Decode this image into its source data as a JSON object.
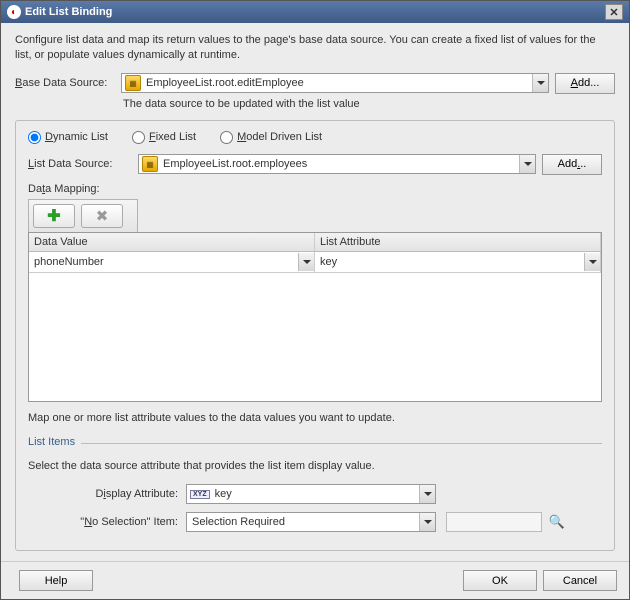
{
  "dialog": {
    "title": "Edit List Binding",
    "description": "Configure list data and map its return values to the page's base data source. You can create a fixed list of values for the list, or populate values dynamically at runtime."
  },
  "baseDataSource": {
    "label": "Base Data Source:",
    "value": "EmployeeList.root.editEmployee",
    "addLabel": "Add...",
    "hint": "The data source to be updated with the list value"
  },
  "listType": {
    "dynamic": "Dynamic List",
    "fixed": "Fixed List",
    "model": "Model Driven List",
    "selected": "dynamic"
  },
  "listDataSource": {
    "label": "List Data Source:",
    "value": "EmployeeList.root.employees",
    "addLabel": "Add..."
  },
  "dataMapping": {
    "label": "Data Mapping:",
    "columns": {
      "dataValue": "Data Value",
      "listAttribute": "List Attribute"
    },
    "rows": [
      {
        "dataValue": "phoneNumber",
        "listAttribute": "key"
      }
    ],
    "hint": "Map one or more list attribute values to the data values you want to update."
  },
  "listItems": {
    "sectionTitle": "List Items",
    "description": "Select the data source attribute that provides the list item display value.",
    "displayAttribute": {
      "label": "Display Attribute:",
      "value": "key"
    },
    "noSelection": {
      "label": "\"No Selection\" Item:",
      "value": "Selection Required"
    }
  },
  "buttons": {
    "help": "Help",
    "ok": "OK",
    "cancel": "Cancel"
  }
}
